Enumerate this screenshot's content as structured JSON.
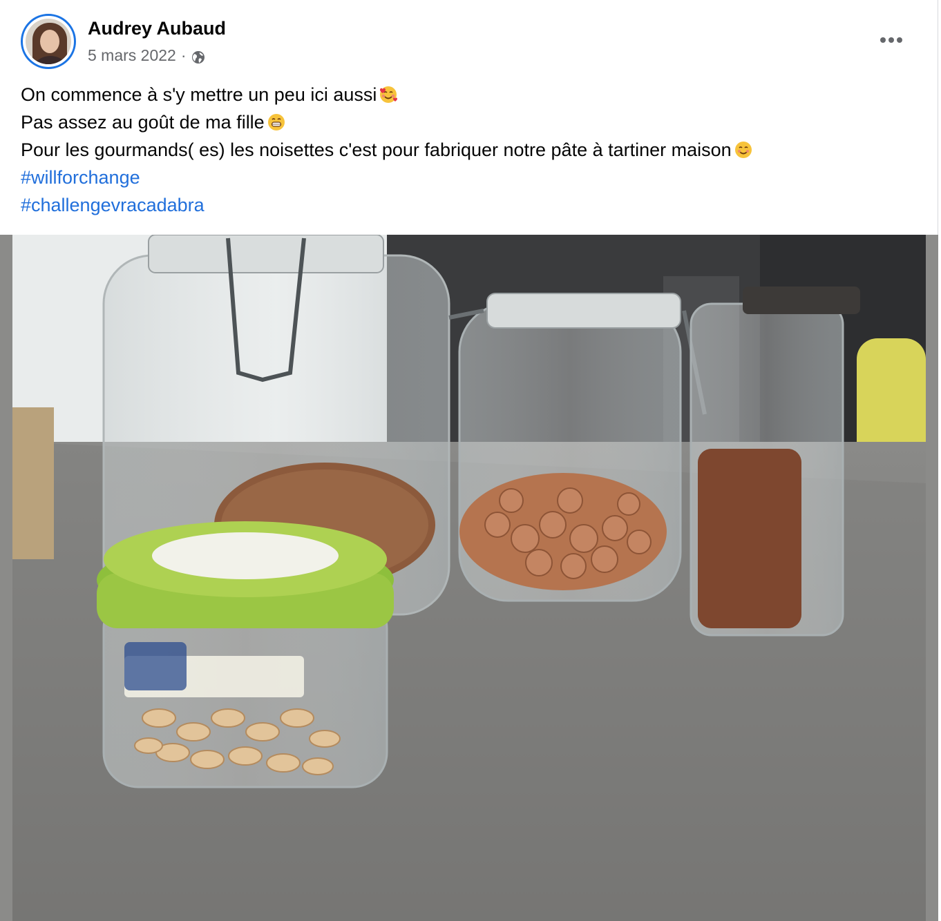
{
  "post": {
    "author": "Audrey Aubaud",
    "date": "5 mars 2022",
    "separator": "·",
    "audience_icon": "globe-icon",
    "more_icon": "more-horizontal-icon",
    "lines": [
      "On commence à s'y mettre un peu ici aussi",
      "Pas assez au goût de ma fille",
      "Pour les gourmands( es) les noisettes c'est pour fabriquer notre pâte à tartiner maison"
    ],
    "line_emojis": [
      "smiling-face-with-hearts-icon",
      "grinning-face-icon",
      "smiling-face-icon"
    ],
    "hashtags": [
      "#willforchange",
      "#challengevracadabra"
    ]
  },
  "colors": {
    "hashtag": "#216fdb",
    "avatar_ring": "#1b74e4",
    "meta_text": "#65676b"
  }
}
